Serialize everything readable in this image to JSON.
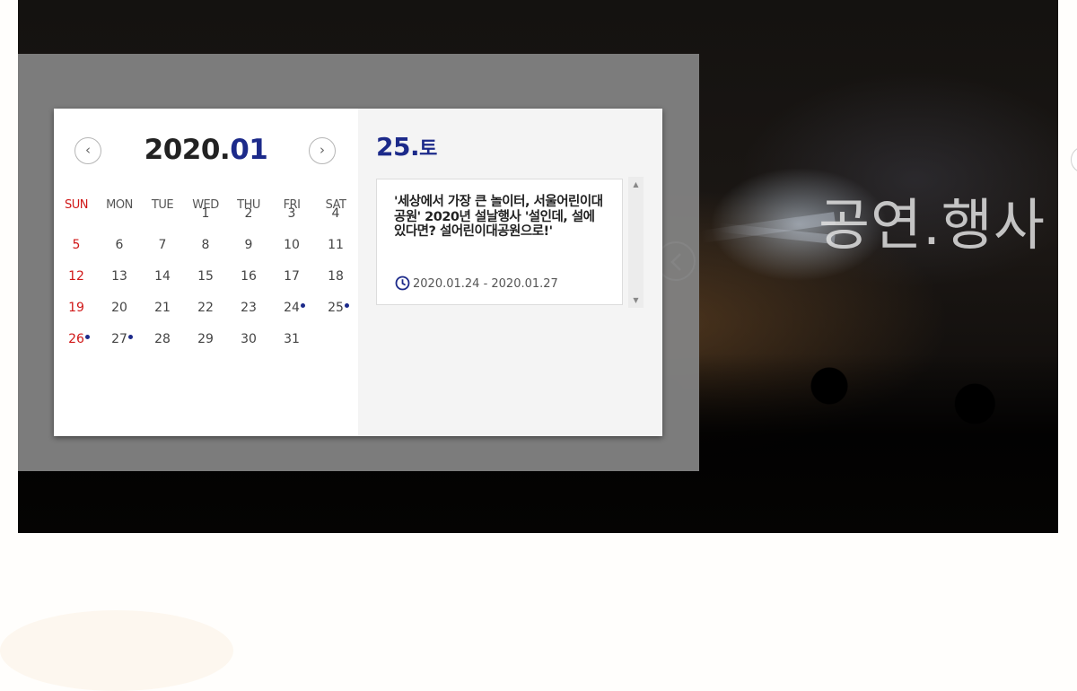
{
  "hero": {
    "title": "공연.행사"
  },
  "calendar": {
    "year": "2020.",
    "month": "01",
    "prev_label": "‹",
    "next_label": "›",
    "weekdays": [
      "SUN",
      "MON",
      "TUE",
      "WED",
      "THU",
      "FRI",
      "SAT"
    ],
    "weeks": [
      [
        "",
        "",
        "",
        "1",
        "2",
        "3",
        "4"
      ],
      [
        "5",
        "6",
        "7",
        "8",
        "9",
        "10",
        "11"
      ],
      [
        "12",
        "13",
        "14",
        "15",
        "16",
        "17",
        "18"
      ],
      [
        "19",
        "20",
        "21",
        "22",
        "23",
        "24",
        "25"
      ],
      [
        "26",
        "27",
        "28",
        "29",
        "30",
        "31",
        ""
      ]
    ],
    "event_days": [
      "24",
      "25",
      "26",
      "27"
    ],
    "accent_color": "#1c2a8a",
    "sunday_color": "#d01818"
  },
  "selected": {
    "day": "25.",
    "weekday": "토"
  },
  "events": [
    {
      "title": "'세상에서 가장 큰 놀이터, 서울어린이대공원' 2020년 설날행사 '설인데, 설에 있다면? 설어린이대공원으로!'",
      "period": "2020.01.24 - 2020.01.27",
      "icon": "clock-icon"
    }
  ],
  "scroll": {
    "up": "▲",
    "down": "▼"
  }
}
